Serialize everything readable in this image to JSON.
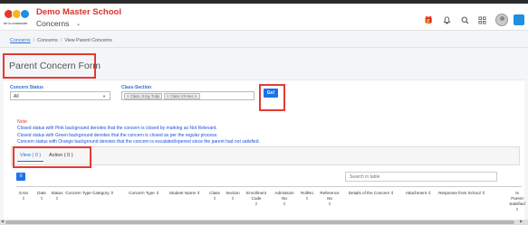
{
  "header": {
    "logo_caption": "MY CLASSBOARD",
    "school_name": "Demo Master School",
    "module_name": "Concerns"
  },
  "breadcrumb": [
    "Concerns",
    "Concerns",
    "View Parent Concerns"
  ],
  "page_title": "Parent Concern Form",
  "filters": {
    "status_label": "Concern Status",
    "status_value": "All",
    "class_label": "Class-Section",
    "class_chips": [
      "Class Jr.Kg-Tulip",
      "Class VII-Sec A"
    ],
    "go_label": "Go!"
  },
  "note": {
    "title": "Note",
    "lines": [
      "Closed status with Pink background denotes that the concern is closed by marking as Not Relevant.",
      "Closed status with Green background denotes that the concern is closed as per the regular process.",
      "Concern status with Orange background denotes that the concern is escalated/opened since the parent had not satisfied."
    ]
  },
  "tabs": {
    "view": "View ( 0 )",
    "action": "Action ( 0 )"
  },
  "table": {
    "search_placeholder": "Search in table",
    "sort_glyph": "⇕",
    "columns": [
      [
        "S.No"
      ],
      [
        "Date"
      ],
      [
        "Status"
      ],
      [
        "Concern Type Category"
      ],
      [
        "Concern Type"
      ],
      [
        "Student Name"
      ],
      [
        "Class"
      ],
      [
        "Section"
      ],
      [
        "Enrollment",
        "Code"
      ],
      [
        "Admission",
        "No"
      ],
      [
        "RollNo"
      ],
      [
        "Reference",
        "No"
      ],
      [
        "Details of the Concern"
      ],
      [
        "Attachment"
      ],
      [
        "Response from School"
      ],
      [
        "Is",
        "Parent",
        "Satisfied"
      ]
    ]
  }
}
